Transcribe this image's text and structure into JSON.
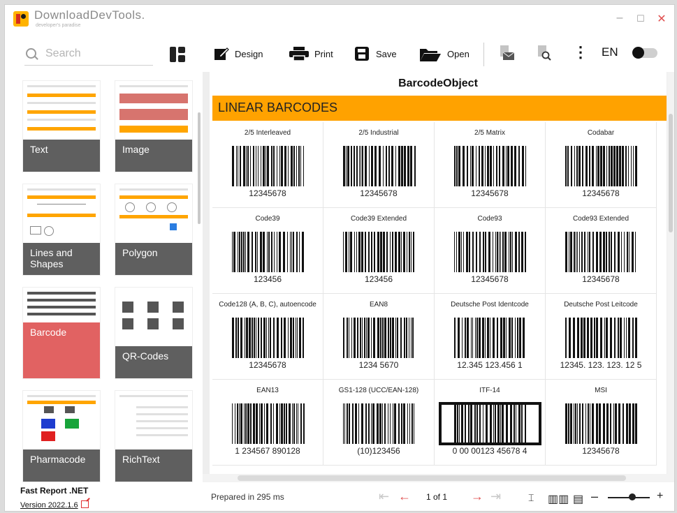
{
  "app": {
    "title": "DownloadDevTools.",
    "subtitle": "developer's paradise",
    "controls": {
      "minimize": "–",
      "maximize": "☐",
      "close": "✕"
    }
  },
  "sidebar": {
    "search_placeholder": "Search",
    "items": [
      {
        "label": "Text"
      },
      {
        "label": "Image"
      },
      {
        "label": "Lines and Shapes"
      },
      {
        "label": "Polygon"
      },
      {
        "label": "Barcode",
        "selected": true
      },
      {
        "label": "QR-Codes"
      },
      {
        "label": "Pharmacode"
      },
      {
        "label": "RichText"
      }
    ],
    "product": "Fast Report .NET",
    "version": "Version 2022.1.6"
  },
  "toolbar": {
    "design": "Design",
    "print": "Print",
    "save": "Save",
    "open": "Open",
    "more": "⋮",
    "language": "EN"
  },
  "report": {
    "title": "BarcodeObject",
    "band": "LINEAR BARCODES",
    "barcodes": [
      {
        "name": "2/5 Interleaved",
        "value": "12345678"
      },
      {
        "name": "2/5 Industrial",
        "value": "12345678"
      },
      {
        "name": "2/5 Matrix",
        "value": "12345678"
      },
      {
        "name": "Codabar",
        "value": "12345678"
      },
      {
        "name": "Code39",
        "value": "123456"
      },
      {
        "name": "Code39 Extended",
        "value": "123456"
      },
      {
        "name": "Code93",
        "value": "12345678"
      },
      {
        "name": "Code93 Extended",
        "value": "12345678"
      },
      {
        "name": "Code128 (A, B, C), autoencode",
        "value": "12345678"
      },
      {
        "name": "EAN8",
        "value": "1234  5670"
      },
      {
        "name": "Deutsche Post Identcode",
        "value": "12.345 123.456 1"
      },
      {
        "name": "Deutsche Post Leitcode",
        "value": "12345. 123. 123. 12 5"
      },
      {
        "name": "EAN13",
        "value": "1  234567  890128"
      },
      {
        "name": "GS1-128 (UCC/EAN-128)",
        "value": "(10)123456"
      },
      {
        "name": "ITF-14",
        "value": "0 00 00123 45678 4"
      },
      {
        "name": "MSI",
        "value": "12345678"
      }
    ]
  },
  "status": {
    "prepared": "Prepared in 295 ms",
    "page": "1 of 1"
  },
  "colors": {
    "band": "#ffa200",
    "accent": "#e05050",
    "selected": "#dc4646"
  }
}
